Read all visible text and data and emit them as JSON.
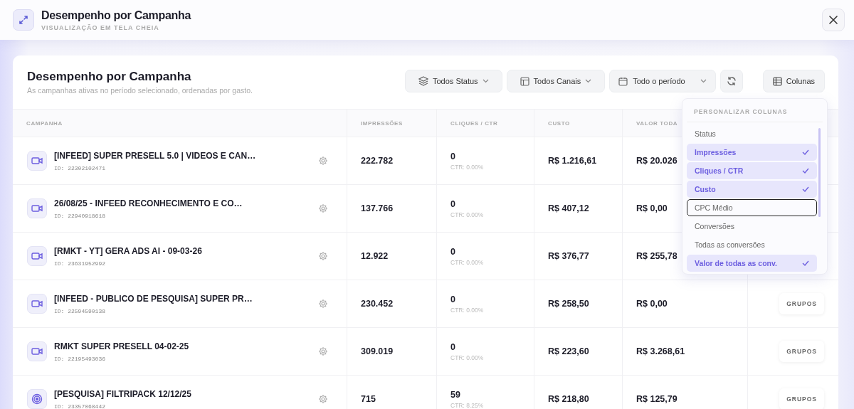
{
  "header": {
    "title": "Desempenho por Campanha",
    "subtitle": "VISUALIZAÇÃO EM TELA CHEIA"
  },
  "card": {
    "title": "Desempenho por Campanha",
    "subtitle": "As campanhas ativas no período selecionado, ordenadas por gasto."
  },
  "filters": [
    {
      "kind": "layers",
      "label": "Todos Status"
    },
    {
      "kind": "layout",
      "label": "Todos Canais"
    },
    {
      "kind": "calendar",
      "label": "Todo o período"
    },
    {
      "kind": "refresh"
    },
    {
      "kind": "columns",
      "label": "Colunas"
    }
  ],
  "table": {
    "columns": [
      "CAMPANHA",
      "IMPRESSÕES",
      "CLIQUES / CTR",
      "CUSTO",
      "VALOR TODA"
    ],
    "rows": [
      {
        "kind": "video",
        "name": "[INFEED] SUPER PRESELL 5.0 | VIDEOS E CAN…",
        "id": "ID: 22302102471",
        "impressions": "222.782",
        "clicks": "0",
        "ctr": "CTR: 0.00%",
        "cost": "R$ 1.216,61",
        "value": "R$ 20.026"
      },
      {
        "kind": "video",
        "name": "26/08/25 - INFEED RECONHECIMENTO E CO…",
        "id": "ID: 22940918618",
        "impressions": "137.766",
        "clicks": "0",
        "ctr": "CTR: 0.00%",
        "cost": "R$ 407,12",
        "value": "R$ 0,00"
      },
      {
        "kind": "video",
        "name": "[RMKT - YT] GERA ADS AI - 09-03-26",
        "id": "ID: 23631952992",
        "impressions": "12.922",
        "clicks": "0",
        "ctr": "CTR: 0.00%",
        "cost": "R$ 376,77",
        "value": "R$ 255,78"
      },
      {
        "kind": "video",
        "name": "[INFEED - PUBLICO DE PESQUISA] SUPER PR…",
        "id": "ID: 22594590138",
        "impressions": "230.452",
        "clicks": "0",
        "ctr": "CTR: 0.00%",
        "cost": "R$ 258,50",
        "value": "R$ 0,00",
        "action": "GRUPOS"
      },
      {
        "kind": "video",
        "name": "RMKT SUPER PRESELL 04-02-25",
        "id": "ID: 22195493036",
        "impressions": "309.019",
        "clicks": "0",
        "ctr": "CTR: 0.00%",
        "cost": "R$ 223,60",
        "value": "R$ 3.268,61",
        "action": "GRUPOS"
      },
      {
        "kind": "search",
        "name": "[PESQUISA] FILTRIPACK 12/12/25",
        "id": "ID: 23357068442",
        "impressions": "715",
        "clicks": "59",
        "ctr": "CTR: 8.25%",
        "cost": "R$ 218,80",
        "value": "R$ 125,79",
        "action": "GRUPOS"
      }
    ]
  },
  "column_menu": {
    "title": "PERSONALIZAR COLUNAS",
    "items": [
      {
        "label": "Status",
        "checked": false,
        "focused": false
      },
      {
        "label": "Impressões",
        "checked": true,
        "focused": false
      },
      {
        "label": "Cliques / CTR",
        "checked": true,
        "focused": false
      },
      {
        "label": "Custo",
        "checked": true,
        "focused": false
      },
      {
        "label": "CPC Médio",
        "checked": false,
        "focused": true
      },
      {
        "label": "Conversões",
        "checked": false,
        "focused": false
      },
      {
        "label": "Todas as conversões",
        "checked": false,
        "focused": false
      },
      {
        "label": "Valor de todas as conv.",
        "checked": true,
        "focused": false
      }
    ]
  }
}
